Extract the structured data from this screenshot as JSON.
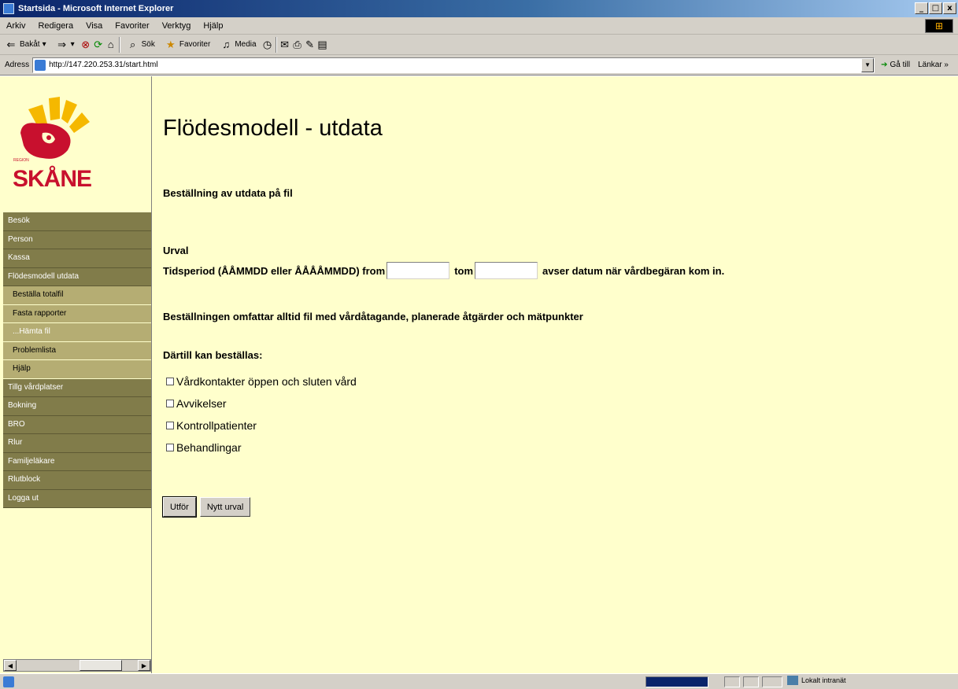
{
  "window": {
    "title": "Startsida - Microsoft Internet Explorer",
    "controls": [
      "_",
      "·",
      "x"
    ]
  },
  "menu": {
    "items": [
      "Arkiv",
      "Redigera",
      "Visa",
      "Favoriter",
      "Verktyg",
      "Hjälp"
    ]
  },
  "toolbar": {
    "back_label": "Bakåt",
    "search_label": "Sök",
    "favorites_label": "Favoriter",
    "media_label": "Media"
  },
  "address": {
    "label": "Adress",
    "url": "http://147.220.253.31/start.html",
    "go_label": "Gå till",
    "links_label": "Länkar »"
  },
  "logo": {
    "region_text": "REGION",
    "name": "SKÅNE"
  },
  "nav": {
    "items": [
      {
        "label": "Besök",
        "level": "top"
      },
      {
        "label": "Person",
        "level": "top"
      },
      {
        "label": "Kassa",
        "level": "top"
      },
      {
        "label": "Flödesmodell utdata",
        "level": "top"
      },
      {
        "label": "Beställa totalfil",
        "level": "sub"
      },
      {
        "label": "Fasta rapporter",
        "level": "sub"
      },
      {
        "label": "...Hämta fil",
        "level": "sub-white"
      },
      {
        "label": "Problemlista",
        "level": "sub"
      },
      {
        "label": "Hjälp",
        "level": "sub"
      },
      {
        "label": "Tillg vårdplatser",
        "level": "top"
      },
      {
        "label": "Bokning",
        "level": "top"
      },
      {
        "label": "BRO",
        "level": "top"
      },
      {
        "label": "Rlur",
        "level": "top"
      },
      {
        "label": "Familjeläkare",
        "level": "top"
      },
      {
        "label": "Rlutblock",
        "level": "top"
      },
      {
        "label": "Logga ut",
        "level": "top"
      }
    ]
  },
  "main": {
    "title": "Flödesmodell - utdata",
    "subtitle": "Beställning av utdata på fil",
    "urval_heading": "Urval",
    "tidsperiod_label": "Tidsperiod",
    "tidsperiod_format": "(ÅÅMMDD eller ÅÅÅÅMMDD)",
    "from_label": "from",
    "from_value": "",
    "tom_label": "tom",
    "tom_value": "",
    "tidsperiod_note": "avser datum när vårdbegäran kom in.",
    "omfattar_text": "Beställningen omfattar alltid fil med vårdåtagande, planerade åtgärder och mätpunkter",
    "dartill_heading": "Därtill kan beställas:",
    "options": [
      {
        "label": "Vårdkontakter öppen och sluten vård",
        "checked": false
      },
      {
        "label": "Avvikelser",
        "checked": false
      },
      {
        "label": "Kontrollpatienter",
        "checked": false
      },
      {
        "label": "Behandlingar",
        "checked": false
      }
    ],
    "submit_label": "Utför",
    "reset_label": "Nytt urval"
  },
  "status": {
    "zone_label": "Lokalt intranät",
    "progress": 1.0
  }
}
